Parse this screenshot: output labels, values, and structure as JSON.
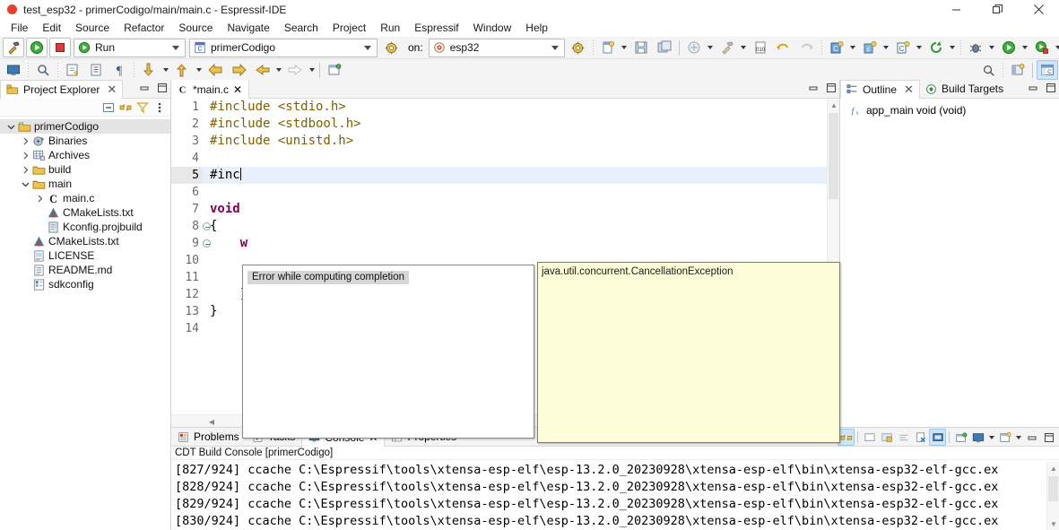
{
  "window": {
    "title": "test_esp32 - primerCodigo/main/main.c - Espressif-IDE",
    "minimize_label": "Minimize",
    "restore_label": "Restore",
    "close_label": "Close"
  },
  "menubar": {
    "items": [
      {
        "label": "File"
      },
      {
        "label": "Edit"
      },
      {
        "label": "Source"
      },
      {
        "label": "Refactor"
      },
      {
        "label": "Source"
      },
      {
        "label": "Navigate"
      },
      {
        "label": "Search"
      },
      {
        "label": "Project"
      },
      {
        "label": "Run"
      },
      {
        "label": "Espressif"
      },
      {
        "label": "Window"
      },
      {
        "label": "Help"
      }
    ]
  },
  "toolbar": {
    "launch_mode": "Run",
    "launch_config": "primerCodigo",
    "on_label": "on:",
    "target": "esp32"
  },
  "project_explorer": {
    "tab_label": "Project Explorer",
    "tree": [
      {
        "label": "primerCodigo",
        "depth": 0,
        "twisty": "down",
        "icon": "project-icon",
        "selected": true
      },
      {
        "label": "Binaries",
        "depth": 1,
        "twisty": "right",
        "icon": "binaries-icon",
        "selected": false
      },
      {
        "label": "Archives",
        "depth": 1,
        "twisty": "right",
        "icon": "archives-icon",
        "selected": false
      },
      {
        "label": "build",
        "depth": 1,
        "twisty": "right",
        "icon": "folder-icon",
        "selected": false
      },
      {
        "label": "main",
        "depth": 1,
        "twisty": "down",
        "icon": "folder-icon",
        "selected": false
      },
      {
        "label": "main.c",
        "depth": 2,
        "twisty": "right",
        "icon": "c-file-icon",
        "selected": false
      },
      {
        "label": "CMakeLists.txt",
        "depth": 2,
        "twisty": "none",
        "icon": "cmake-icon",
        "selected": false
      },
      {
        "label": "Kconfig.projbuild",
        "depth": 2,
        "twisty": "none",
        "icon": "text-file-icon",
        "selected": false
      },
      {
        "label": "CMakeLists.txt",
        "depth": 1,
        "twisty": "none",
        "icon": "cmake-icon",
        "selected": false
      },
      {
        "label": "LICENSE",
        "depth": 1,
        "twisty": "none",
        "icon": "license-icon",
        "selected": false
      },
      {
        "label": "README.md",
        "depth": 1,
        "twisty": "none",
        "icon": "readme-icon",
        "selected": false
      },
      {
        "label": "sdkconfig",
        "depth": 1,
        "twisty": "none",
        "icon": "config-icon",
        "selected": false
      }
    ]
  },
  "editor": {
    "tab_label": "*main.c",
    "lines": [
      {
        "number": "1",
        "fold": false,
        "current": false,
        "tokens": [
          {
            "t": "#include ",
            "c": "kw-pp"
          },
          {
            "t": "<stdio.h>",
            "c": "kw-pp"
          }
        ]
      },
      {
        "number": "2",
        "fold": false,
        "current": false,
        "tokens": [
          {
            "t": "#include ",
            "c": "kw-pp"
          },
          {
            "t": "<stdbool.h>",
            "c": "kw-pp"
          }
        ]
      },
      {
        "number": "3",
        "fold": false,
        "current": false,
        "tokens": [
          {
            "t": "#include ",
            "c": "kw-pp"
          },
          {
            "t": "<unistd.h>",
            "c": "kw-pp"
          }
        ]
      },
      {
        "number": "4",
        "fold": false,
        "current": false,
        "tokens": []
      },
      {
        "number": "5",
        "fold": false,
        "current": true,
        "tokens": [
          {
            "t": "#inc",
            "c": "plain"
          }
        ]
      },
      {
        "number": "6",
        "fold": false,
        "current": false,
        "tokens": []
      },
      {
        "number": "7",
        "fold": false,
        "current": false,
        "tokens": [
          {
            "t": "void",
            "c": "kw"
          }
        ]
      },
      {
        "number": "8",
        "fold": true,
        "current": false,
        "tokens": [
          {
            "t": "{",
            "c": "plain"
          }
        ]
      },
      {
        "number": "9",
        "fold": true,
        "current": false,
        "tokens": [
          {
            "t": "    w",
            "c": "kw"
          }
        ]
      },
      {
        "number": "10",
        "fold": false,
        "current": false,
        "tokens": []
      },
      {
        "number": "11",
        "fold": false,
        "current": false,
        "tokens": []
      },
      {
        "number": "12",
        "fold": false,
        "current": false,
        "tokens": [
          {
            "t": "    }",
            "c": "plain"
          }
        ]
      },
      {
        "number": "13",
        "fold": false,
        "current": false,
        "tokens": [
          {
            "t": "}",
            "c": "plain"
          }
        ]
      },
      {
        "number": "14",
        "fold": false,
        "current": false,
        "tokens": []
      }
    ]
  },
  "completion_popup": {
    "error_message": "Error while computing completion",
    "doc_text": "java.util.concurrent.CancellationException"
  },
  "outline": {
    "tabs": [
      {
        "label": "Outline",
        "icon": "outline-icon",
        "active": true,
        "closable": true
      },
      {
        "label": "Build Targets",
        "icon": "build-target-icon",
        "active": false,
        "closable": false
      }
    ],
    "items": [
      {
        "label": "app_main void (void)",
        "icon": "function-icon"
      }
    ]
  },
  "console": {
    "tabs": [
      {
        "label": "Problems",
        "icon": "problems-icon",
        "active": false,
        "closable": false
      },
      {
        "label": "Tasks",
        "icon": "tasks-icon",
        "active": false,
        "closable": false
      },
      {
        "label": "Console",
        "icon": "console-icon",
        "active": true,
        "closable": true
      },
      {
        "label": "Properties",
        "icon": "properties-icon",
        "active": false,
        "closable": false
      }
    ],
    "title": "CDT Build Console [primerCodigo]",
    "lines": [
      "[827/924] ccache C:\\Espressif\\tools\\xtensa-esp-elf\\esp-13.2.0_20230928\\xtensa-esp-elf\\bin\\xtensa-esp32-elf-gcc.ex",
      "[828/924] ccache C:\\Espressif\\tools\\xtensa-esp-elf\\esp-13.2.0_20230928\\xtensa-esp-elf\\bin\\xtensa-esp32-elf-gcc.ex",
      "[829/924] ccache C:\\Espressif\\tools\\xtensa-esp-elf\\esp-13.2.0_20230928\\xtensa-esp-elf\\bin\\xtensa-esp32-elf-gcc.ex",
      "[830/924] ccache C:\\Espressif\\tools\\xtensa-esp-elf\\esp-13.2.0_20230928\\xtensa-esp-elf\\bin\\xtensa-esp32-elf-gcc.ex"
    ]
  },
  "colors": {
    "accent_blue": "#3b7dd8",
    "folder_yellow": "#f0c14b",
    "run_green": "#2fa02f",
    "stop_red": "#cc2f2f",
    "doc_popup_bg": "#fdfdd9",
    "selection_blue": "#e8f0fb"
  }
}
